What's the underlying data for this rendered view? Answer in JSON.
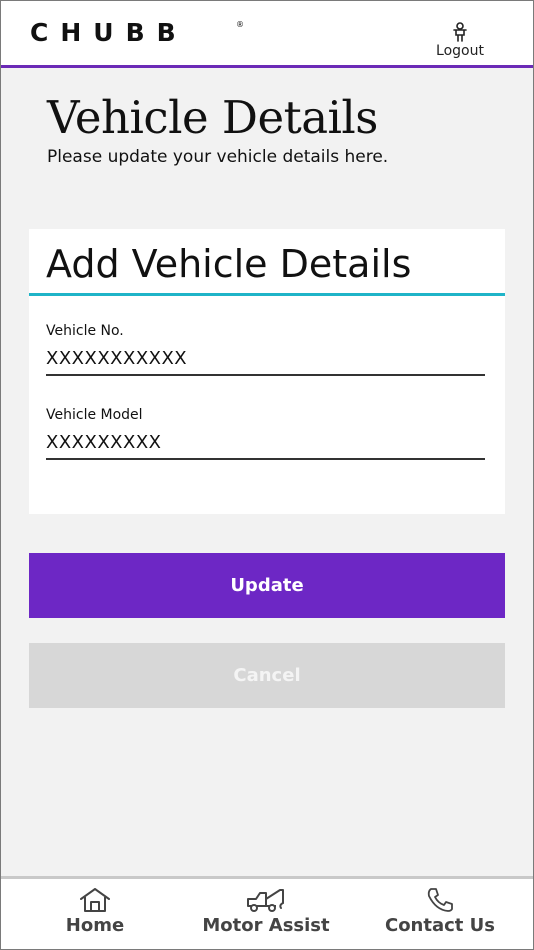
{
  "header": {
    "logo_text": "CHUBB",
    "logo_mark": "®",
    "logout_label": "Logout",
    "logout_icon": "person-icon",
    "accent_color": "#6b2ab6"
  },
  "page": {
    "title": "Vehicle Details",
    "subtitle": "Please update your vehicle details here."
  },
  "card": {
    "title": "Add Vehicle Details",
    "divider_color": "#1fb4c8",
    "fields": [
      {
        "label": "Vehicle No.",
        "value": "XXXXXXXXXXX"
      },
      {
        "label": "Vehicle Model",
        "value": "XXXXXXXXX"
      }
    ]
  },
  "actions": {
    "update_label": "Update",
    "update_color": "#6d27c5",
    "cancel_label": "Cancel",
    "cancel_color": "#d7d7d7"
  },
  "bottom_nav": {
    "items": [
      {
        "label": "Home",
        "icon": "home-icon"
      },
      {
        "label": "Motor Assist",
        "icon": "tow-truck-icon"
      },
      {
        "label": "Contact Us",
        "icon": "phone-icon"
      }
    ]
  }
}
